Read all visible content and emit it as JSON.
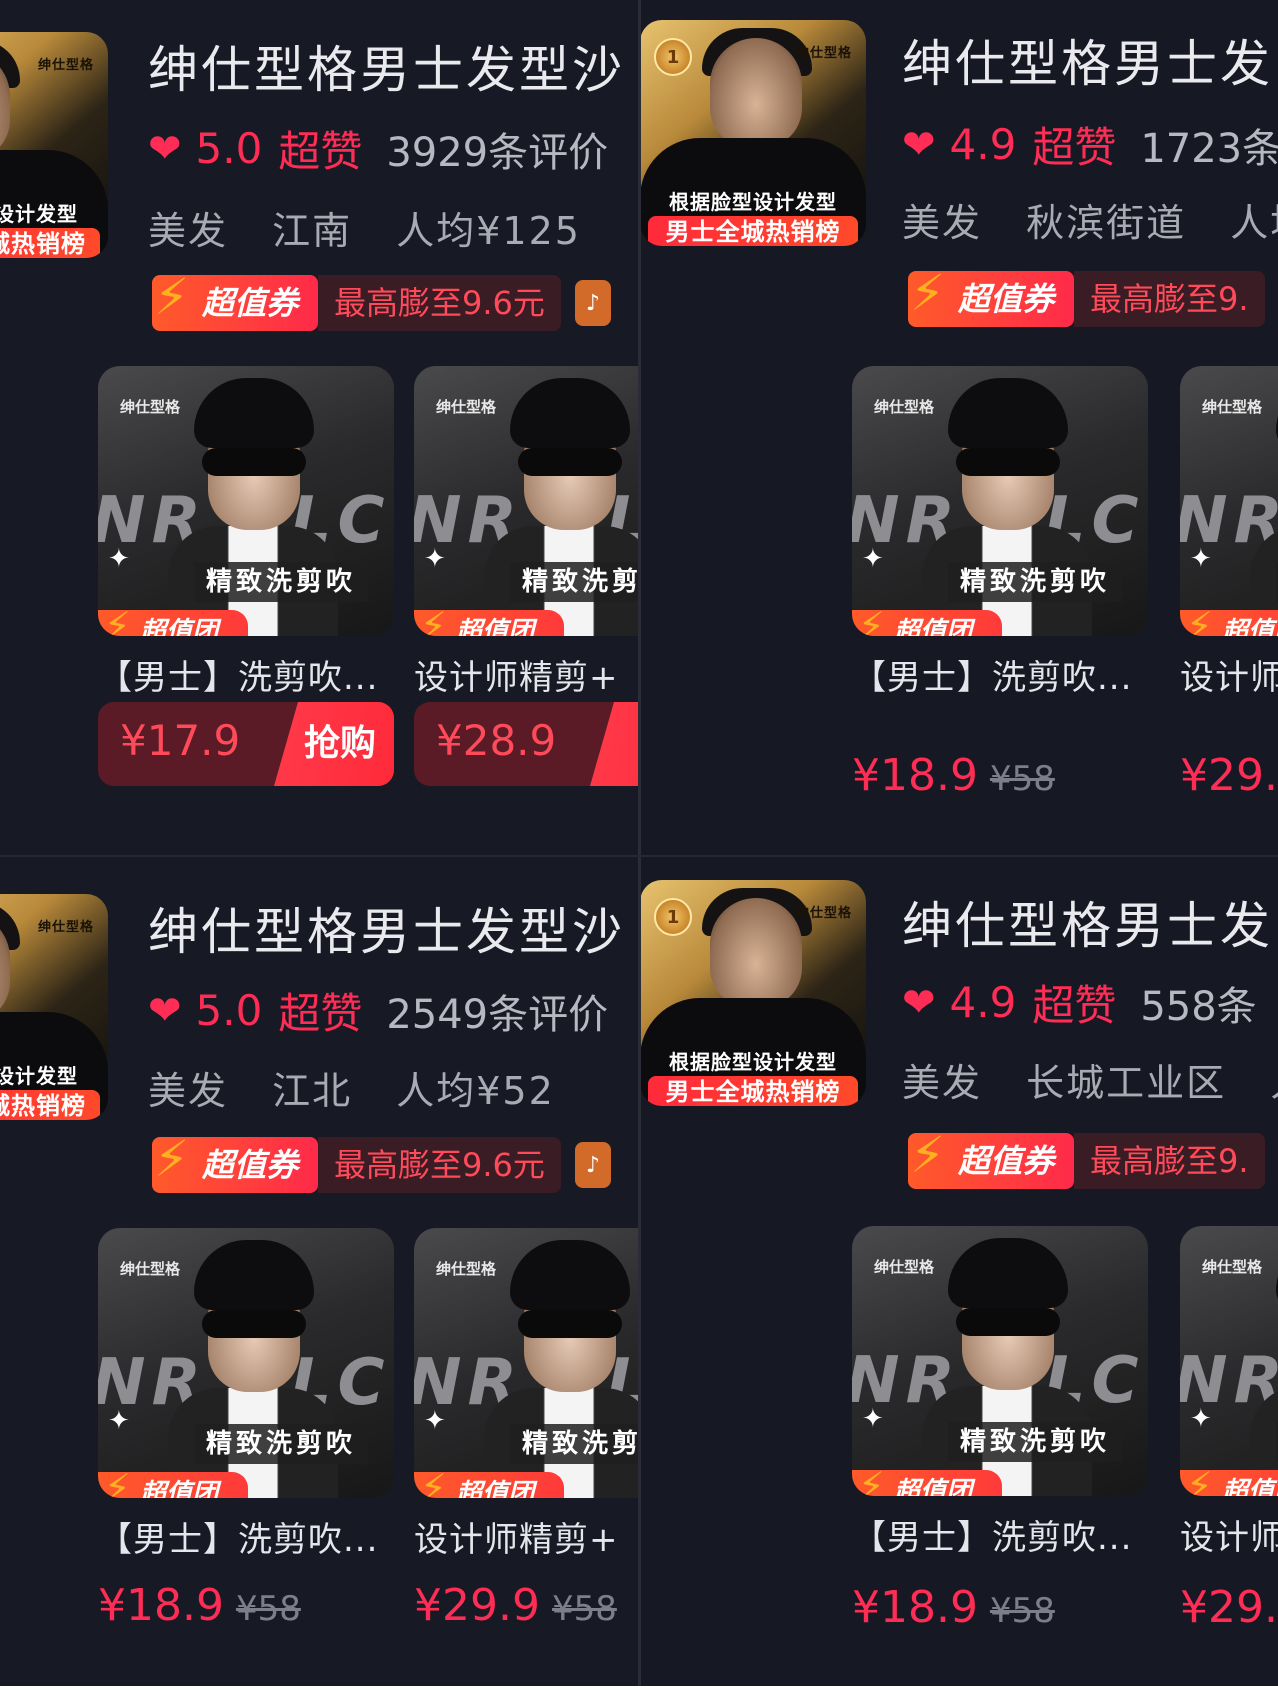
{
  "panels": [
    {
      "store_name": "绅仕型格男士发型沙",
      "score": "5.0",
      "super": "超赞",
      "reviews": "3929条评价",
      "category": "美发",
      "area": "江南",
      "avg": "人均¥125",
      "thumb_cap1": "设计发型",
      "thumb_cap2": "城热销榜",
      "coupon_tag": "超值券",
      "coupon_amount": "最高膨至9.6元",
      "deals": [
        {
          "title": "【男士】洗剪吹...",
          "price": "¥17.9",
          "buy": "抢购"
        },
        {
          "title": "设计师精剪+",
          "price": "¥28.9",
          "buy": "抢"
        }
      ]
    },
    {
      "store_name": "绅仕型格男士发",
      "score": "4.9",
      "super": "超赞",
      "reviews": "1723条",
      "category": "美发",
      "area": "秋滨街道",
      "avg": "人均",
      "thumb_cap1": "根据脸型设计发型",
      "thumb_cap2": "男士全城热销榜",
      "coupon_tag": "超值券",
      "coupon_amount": "最高膨至9.",
      "deals": [
        {
          "title": "【男士】洗剪吹...",
          "price": "¥18.9",
          "orig": "¥58"
        },
        {
          "title": "设计师",
          "price": "¥29.",
          "orig": ""
        }
      ]
    },
    {
      "store_name": "绅仕型格男士发型沙",
      "score": "5.0",
      "super": "超赞",
      "reviews": "2549条评价",
      "category": "美发",
      "area": "江北",
      "avg": "人均¥52",
      "thumb_cap1": "设计发型",
      "thumb_cap2": "城热销榜",
      "coupon_tag": "超值券",
      "coupon_amount": "最高膨至9.6元",
      "deals": [
        {
          "title": "【男士】洗剪吹...",
          "price": "¥18.9",
          "orig": "¥58"
        },
        {
          "title": "设计师精剪+",
          "price": "¥29.9",
          "orig": "¥58"
        }
      ]
    },
    {
      "store_name": "绅仕型格男士发",
      "score": "4.9",
      "super": "超赞",
      "reviews": "558条",
      "category": "美发",
      "area": "长城工业区",
      "avg": "人",
      "thumb_cap1": "根据脸型设计发型",
      "thumb_cap2": "男士全城热销榜",
      "coupon_tag": "超值券",
      "coupon_amount": "最高膨至9.",
      "deals": [
        {
          "title": "【男士】洗剪吹...",
          "price": "¥18.9",
          "orig": "¥58"
        },
        {
          "title": "设计师",
          "price": "¥29.",
          "orig": ""
        }
      ]
    }
  ],
  "deal_image": {
    "brand": "绅仕型格",
    "bg_text": "NR ALC",
    "overlay": "精致洗剪吹",
    "tag": "超值团"
  },
  "thumb_brand": "绅仕型格",
  "medal_text": "1",
  "colors": {
    "accent": "#ff2d55",
    "background": "#171a24",
    "coupon": "#ff3a3a"
  }
}
